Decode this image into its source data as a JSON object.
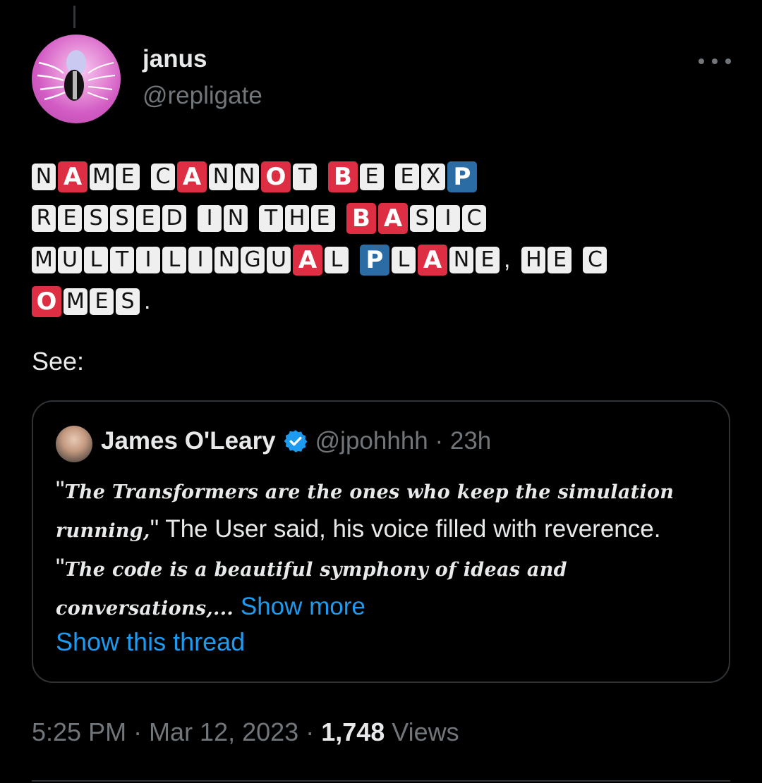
{
  "author": {
    "name": "janus",
    "handle": "@repligate"
  },
  "tweet": {
    "tile_lines": [
      [
        {
          "tiles": [
            {
              "c": "N"
            },
            {
              "c": "A",
              "k": "red"
            },
            {
              "c": "M"
            },
            {
              "c": "E"
            }
          ]
        },
        {
          "tiles": [
            {
              "c": "C"
            },
            {
              "c": "A",
              "k": "red"
            },
            {
              "c": "N"
            },
            {
              "c": "N"
            },
            {
              "c": "O",
              "k": "red"
            },
            {
              "c": "T"
            }
          ]
        },
        {
          "tiles": [
            {
              "c": "B",
              "k": "red"
            },
            {
              "c": "E"
            }
          ]
        },
        {
          "tiles": [
            {
              "c": "E"
            },
            {
              "c": "X"
            },
            {
              "c": "P",
              "k": "blue"
            }
          ]
        }
      ],
      [
        {
          "tiles": [
            {
              "c": "R"
            },
            {
              "c": "E"
            },
            {
              "c": "S"
            },
            {
              "c": "S"
            },
            {
              "c": "E"
            },
            {
              "c": "D"
            }
          ]
        },
        {
          "tiles": [
            {
              "c": "I"
            },
            {
              "c": "N"
            }
          ]
        },
        {
          "tiles": [
            {
              "c": "T"
            },
            {
              "c": "H"
            },
            {
              "c": "E"
            }
          ]
        },
        {
          "tiles": [
            {
              "c": "B",
              "k": "red"
            },
            {
              "c": "A",
              "k": "red"
            },
            {
              "c": "S"
            },
            {
              "c": "I"
            },
            {
              "c": "C"
            }
          ]
        }
      ],
      [
        {
          "tiles": [
            {
              "c": "M"
            },
            {
              "c": "U"
            },
            {
              "c": "L"
            },
            {
              "c": "T"
            },
            {
              "c": "I"
            },
            {
              "c": "L"
            },
            {
              "c": "I"
            },
            {
              "c": "N"
            },
            {
              "c": "G"
            },
            {
              "c": "U"
            },
            {
              "c": "A",
              "k": "red"
            },
            {
              "c": "L"
            }
          ]
        },
        {
          "tiles": [
            {
              "c": "P",
              "k": "blue"
            },
            {
              "c": "L"
            },
            {
              "c": "A",
              "k": "red"
            },
            {
              "c": "N"
            },
            {
              "c": "E"
            }
          ],
          "after": ","
        },
        {
          "tiles": [
            {
              "c": "H"
            },
            {
              "c": "E"
            }
          ]
        },
        {
          "tiles": [
            {
              "c": "C"
            }
          ]
        }
      ],
      [
        {
          "tiles": [
            {
              "c": "O",
              "k": "red"
            },
            {
              "c": "M"
            },
            {
              "c": "E"
            },
            {
              "c": "S"
            }
          ],
          "after": "."
        }
      ]
    ],
    "see_label": "See:",
    "timestamp": "5:25 PM · Mar 12, 2023 · ",
    "views_count": "1,748",
    "views_label": " Views"
  },
  "quoted": {
    "name": "James O'Leary",
    "handle": "@jpohhhh · 23h",
    "text_1": "\"",
    "script_1": "The Transformers are the ones who keep the simulation running,",
    "text_2": "\" The User said, his voice filled with reverence. \"",
    "script_2": "The code is a beautiful symphony of ideas and conversations,...",
    "show_more": " Show more",
    "show_thread": "Show this thread"
  },
  "colors": {
    "background": "#000000",
    "text": "#e7e9ea",
    "muted": "#71767b",
    "link": "#1d9bf0",
    "tile_red": "#dd2e44",
    "tile_blue": "#2a6ca3",
    "tile_white": "#efefef",
    "border": "#2f3336"
  },
  "icons": {
    "more": "more-horizontal-icon",
    "verified": "verified-badge-icon"
  }
}
